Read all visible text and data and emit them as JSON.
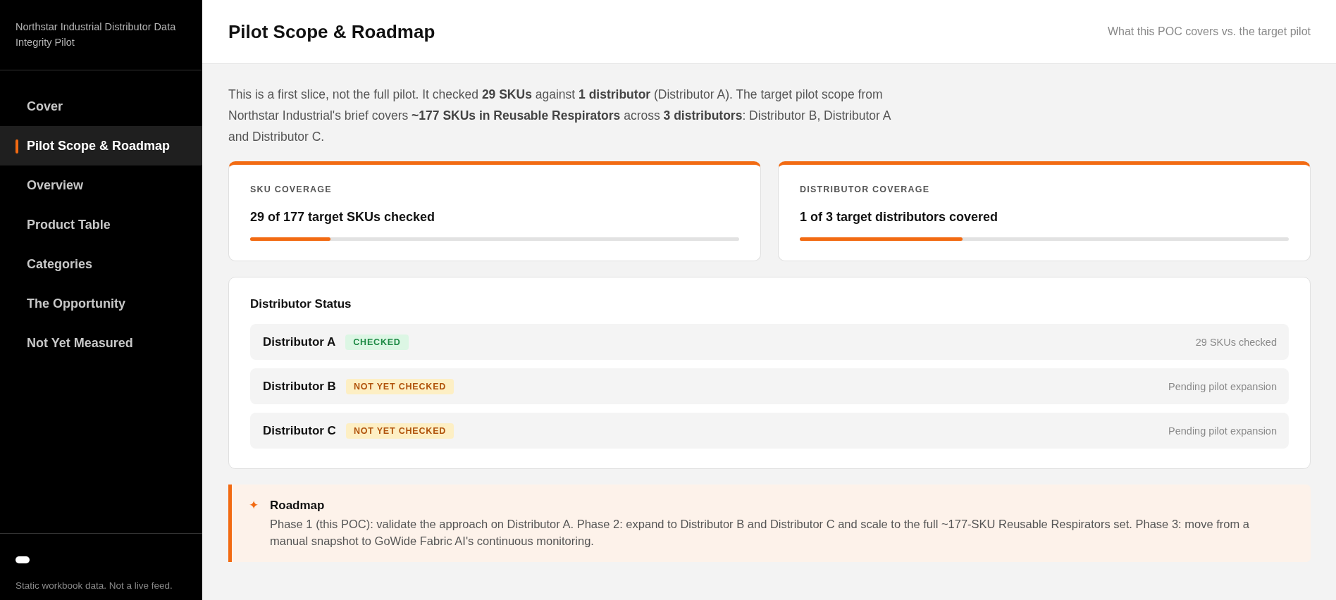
{
  "sidebar": {
    "title": "Northstar Industrial Distributor Data Integrity Pilot",
    "items": [
      {
        "label": "Cover",
        "selected": false
      },
      {
        "label": "Pilot Scope & Roadmap",
        "selected": true
      },
      {
        "label": "Overview",
        "selected": false
      },
      {
        "label": "Product Table",
        "selected": false
      },
      {
        "label": "Categories",
        "selected": false
      },
      {
        "label": "The Opportunity",
        "selected": false
      },
      {
        "label": "Not Yet Measured",
        "selected": false
      }
    ],
    "footer": "Static workbook data. Not a live feed."
  },
  "header": {
    "title": "Pilot Scope & Roadmap",
    "subtitle": "What this POC covers vs. the target pilot"
  },
  "intro": "This is a first slice, not the full pilot. It checked **29 SKUs** against **1 distributor** (Distributor A). The target pilot scope from Northstar Industrial's brief covers **~177 SKUs in Reusable Respirators** across **3 distributors**: Distributor B, Distributor A and Distributor C.",
  "coverage": [
    {
      "label": "SKU COVERAGE",
      "value": "29 of 177 target SKUs checked",
      "level": 0.164
    },
    {
      "label": "DISTRIBUTOR COVERAGE",
      "value": "1 of 3 target distributors covered",
      "level": 0.333
    }
  ],
  "distributor_status": {
    "title": "Distributor Status",
    "rows": [
      {
        "name": "Distributor A",
        "status": "CHECKED",
        "kind": "checked",
        "note": "29 SKUs checked"
      },
      {
        "name": "Distributor B",
        "status": "NOT YET CHECKED",
        "kind": "pending",
        "note": "Pending pilot expansion"
      },
      {
        "name": "Distributor C",
        "status": "NOT YET CHECKED",
        "kind": "pending",
        "note": "Pending pilot expansion"
      }
    ]
  },
  "roadmap": {
    "icon": "✦",
    "title": "Roadmap",
    "text": "Phase 1 (this POC): validate the approach on Distributor A. Phase 2: expand to Distributor B and Distributor C and scale to the full ~177-SKU Reusable Respirators set. Phase 3: move from a manual snapshot to GoWide Fabric AI's continuous monitoring."
  }
}
